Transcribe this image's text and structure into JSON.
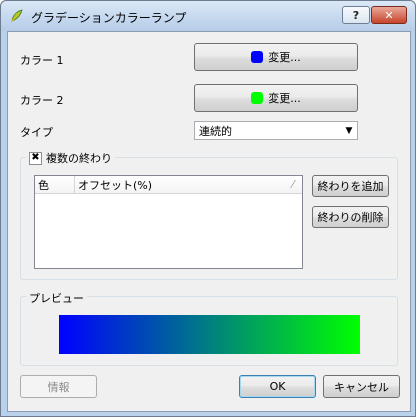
{
  "window": {
    "title": "グラデーションカラーランプ",
    "help_label": "?",
    "close_label": "✕"
  },
  "color1": {
    "label": "カラー 1",
    "button_label": "変更...",
    "color": "#0000ff"
  },
  "color2": {
    "label": "カラー 2",
    "button_label": "変更...",
    "color": "#00ff00"
  },
  "type": {
    "label": "タイプ",
    "value": "連続的"
  },
  "multi_stop": {
    "checkbox_label": "複数の終わり",
    "checked": true,
    "columns": [
      "色",
      "オフセット(%)"
    ],
    "rows": [],
    "add_label": "終わりを追加",
    "remove_label": "終わりの削除"
  },
  "preview": {
    "label": "プレビュー",
    "gradient_start": "#0000ff",
    "gradient_end": "#00ff00"
  },
  "footer": {
    "info_label": "情報",
    "ok_label": "OK",
    "cancel_label": "キャンセル"
  }
}
